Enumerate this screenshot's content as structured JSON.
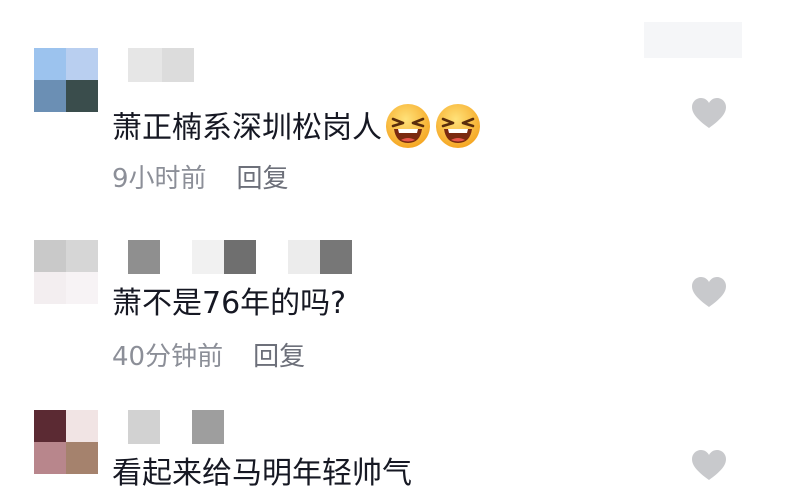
{
  "comments": [
    {
      "text": "萧正楠系深圳松岗人",
      "emoji": [
        "laughing-face",
        "laughing-face"
      ],
      "time": "9小时前",
      "reply": "回复",
      "like_icon": "heart-icon"
    },
    {
      "text": "萧不是76年的吗?",
      "time": "40分钟前",
      "reply": "回复",
      "like_icon": "heart-icon"
    },
    {
      "text": "看起来给马明年轻帅气",
      "like_icon": "heart-icon"
    }
  ],
  "colors": {
    "text": "#161823",
    "meta": "#8c8f98",
    "heart": "#c8c9cc"
  }
}
